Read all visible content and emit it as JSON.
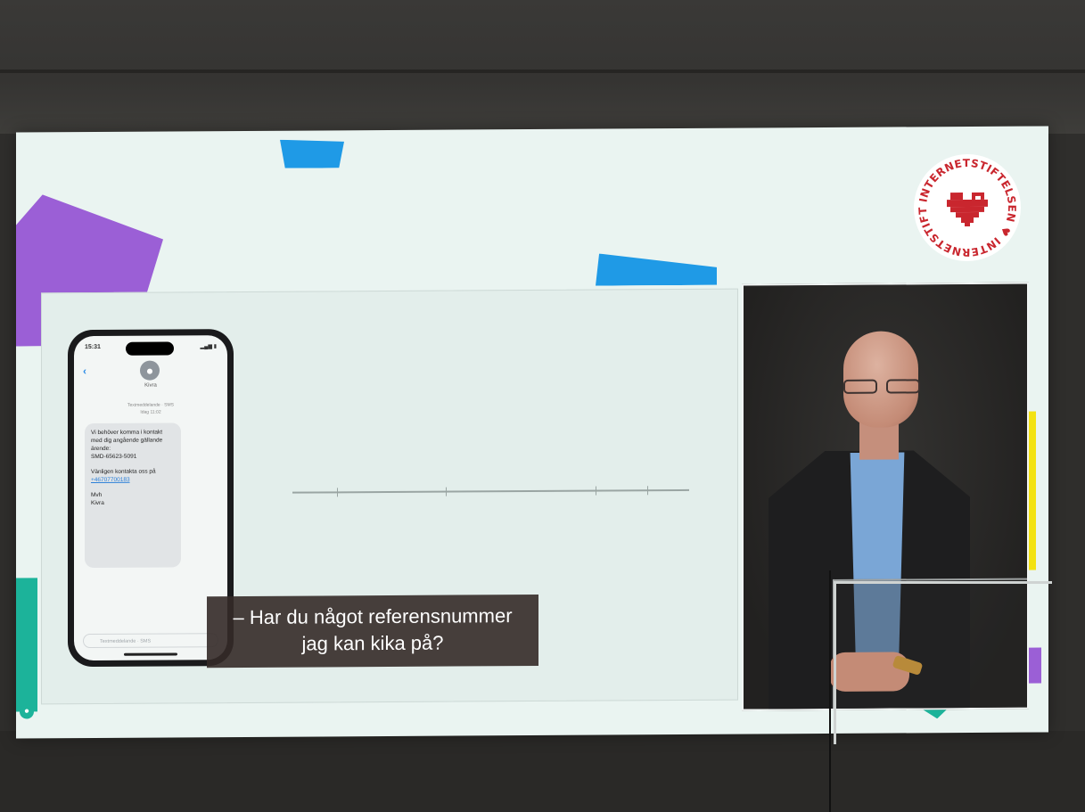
{
  "slide": {
    "logo": {
      "text": "INTERNETSTIFTELSEN",
      "color": "#c9262e",
      "icon": "pixel-heart-icon"
    },
    "phone": {
      "status_time": "15:31",
      "contact_name": "Kivra",
      "message_meta": "Textmeddelande · SMS",
      "message_time": "Idag 11:02",
      "message_line1": "Vi behöver komma i kontakt med dig angående gällande ärende:",
      "reference": "SMD-65623-5091",
      "message_line2": "Vänligen kontakta oss på",
      "phone_link": "+46707700183",
      "sign_off": "Mvh",
      "sender": "Kivra",
      "input_placeholder": "Textmeddelande · SMS"
    },
    "subtitle": {
      "line1": "– Har du något referensnummer",
      "line2": "jag kan kika på?"
    }
  },
  "colors": {
    "slide_bg": "#eaf4f1",
    "purple": "#9b5fd6",
    "blue": "#1f9ae6",
    "yellow": "#f3e212",
    "teal": "#1cb39a"
  }
}
